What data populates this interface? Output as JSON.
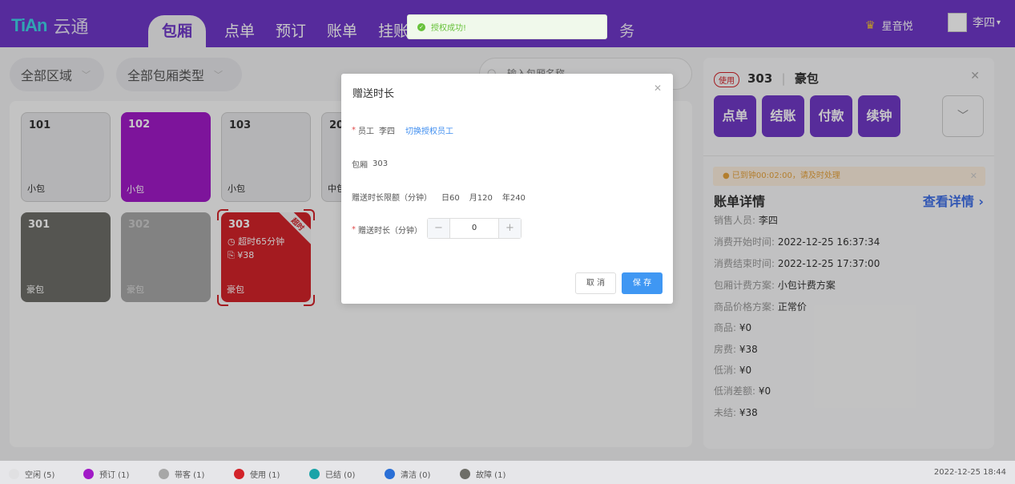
{
  "app": {
    "logo_mark": "TiAn",
    "logo_text": "云通",
    "brand_icon": "crown-icon",
    "brand": "星音悦",
    "user": "李四"
  },
  "nav": {
    "items": [
      "包厢",
      "点单",
      "预订",
      "账单",
      "挂账",
      "务"
    ]
  },
  "toast": {
    "text": "授权成功!"
  },
  "filters": {
    "area": "全部区域",
    "room_type": "全部包厢类型",
    "search_placeholder": "输入包厢名称"
  },
  "rooms": [
    {
      "num": "101",
      "type": "小包",
      "status": "idle"
    },
    {
      "num": "102",
      "type": "小包",
      "status": "booked"
    },
    {
      "num": "103",
      "type": "小包",
      "status": "idle"
    },
    {
      "num": "20",
      "type": "中包",
      "status": "idle"
    },
    {
      "num": "301",
      "type": "豪包",
      "status": "fault"
    },
    {
      "num": "302",
      "type": "豪包",
      "status": "guest"
    },
    {
      "num": "303",
      "type": "豪包",
      "status": "used",
      "ribbon": "超时",
      "overtime": "超时65分钟",
      "amount": "¥38"
    }
  ],
  "right_panel": {
    "badge": "使用",
    "room": "303",
    "room_type": "豪包",
    "actions": [
      "点单",
      "结账",
      "付款",
      "续钟"
    ],
    "warning": "已到钟00:02:00，请及时处理",
    "section_title": "账单详情",
    "detail_link": "查看详情",
    "details": [
      {
        "label": "销售人员:",
        "value": "李四"
      },
      {
        "label": "消费开始时间:",
        "value": "2022-12-25 16:37:34"
      },
      {
        "label": "消费结束时间:",
        "value": "2022-12-25 17:37:00"
      },
      {
        "label": "包厢计费方案:",
        "value": "小包计费方案"
      },
      {
        "label": "商品价格方案:",
        "value": "正常价"
      },
      {
        "label": "商品:",
        "value": "¥0"
      },
      {
        "label": "房费:",
        "value": "¥38"
      },
      {
        "label": "低消:",
        "value": "¥0"
      },
      {
        "label": "低消差额:",
        "value": "¥0"
      },
      {
        "label": "未结:",
        "value": "¥38"
      }
    ]
  },
  "modal": {
    "title": "赠送时长",
    "employee_label": "员工",
    "employee": "李四",
    "switch_link": "切换授权员工",
    "room_label": "包厢",
    "room": "303",
    "limit_label": "赠送时长限额（分钟）",
    "limit_day": "日60",
    "limit_month": "月120",
    "limit_year": "年240",
    "duration_label": "赠送时长（分钟）",
    "duration_value": "0",
    "cancel": "取 消",
    "save": "保 存"
  },
  "status_bar": {
    "legend": [
      {
        "label": "空闲 (5)",
        "color": "#e0e0e2"
      },
      {
        "label": "预订 (1)",
        "color": "#a11ac7"
      },
      {
        "label": "带客 (1)",
        "color": "#a7a7a7"
      },
      {
        "label": "使用 (1)",
        "color": "#d2232a"
      },
      {
        "label": "已结 (0)",
        "color": "#1aa3a8"
      },
      {
        "label": "清洁 (0)",
        "color": "#2a6fd6"
      },
      {
        "label": "故障 (1)",
        "color": "#6e6e68"
      }
    ],
    "datetime": "2022-12-25 18:44"
  }
}
